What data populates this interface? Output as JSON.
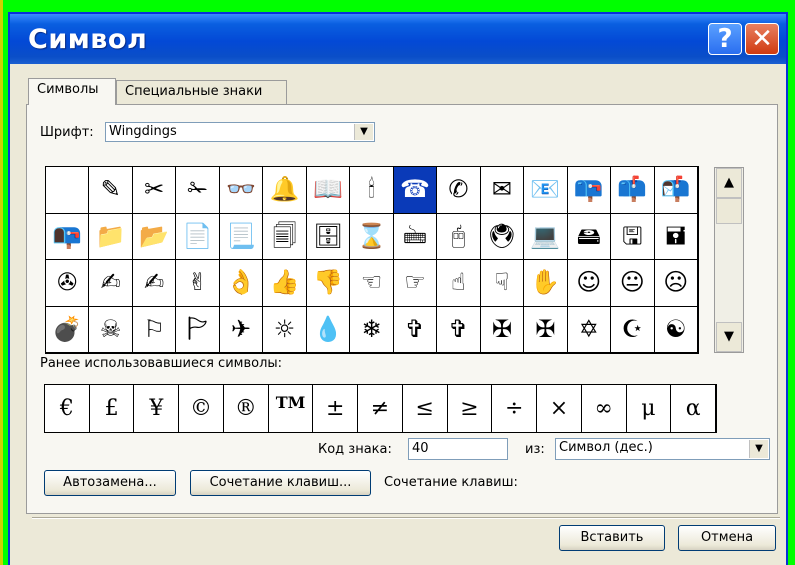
{
  "window": {
    "title": "Символ",
    "help_glyph": "?",
    "close_glyph": "✕"
  },
  "tabs": [
    {
      "label": "Символы",
      "active": true
    },
    {
      "label": "Специальные знаки",
      "active": false
    }
  ],
  "font": {
    "label": "Шрифт:",
    "value": "Wingdings"
  },
  "symbols": [
    [
      "",
      "✎",
      "✂",
      "✁",
      "👓",
      "🔔",
      "📖",
      "🕯",
      "☎",
      "✆",
      "✉",
      "📧",
      "📪",
      "📫",
      "📬"
    ],
    [
      "📭",
      "📁",
      "📂",
      "📄",
      "📃",
      "🗐",
      "🗄",
      "⌛",
      "🖮",
      "🖰",
      "🖲",
      "💻",
      "🖴",
      "🖫",
      "🖬"
    ],
    [
      "✇",
      "✍",
      "✍",
      "✌",
      "👌",
      "👍",
      "👎",
      "☜",
      "☞",
      "☝",
      "☟",
      "✋",
      "☺",
      "😐",
      "☹"
    ],
    [
      "💣",
      "☠",
      "⚐",
      "🏱",
      "✈",
      "☼",
      "💧",
      "❄",
      "✞",
      "✞",
      "✠",
      "✠",
      "✡",
      "☪",
      "☯"
    ]
  ],
  "selected_symbol": "☎",
  "recent": {
    "label": "Ранее использовавшиеся символы:",
    "items": [
      "€",
      "£",
      "¥",
      "©",
      "®",
      "TM",
      "±",
      "≠",
      "≤",
      "≥",
      "÷",
      "×",
      "∞",
      "μ",
      "α"
    ]
  },
  "code": {
    "label": "Код знака:",
    "value": "40",
    "from_label": "из:",
    "from_value": "Символ (дес.)"
  },
  "buttons": {
    "autocorrect": "Автозамена...",
    "shortcut_key": "Сочетание клавиш...",
    "shortcut_label": "Сочетание клавиш:",
    "insert": "Вставить",
    "cancel": "Отмена"
  },
  "scroll": {
    "up": "▲",
    "down": "▼"
  },
  "colors": {
    "titlebar": "#0349d6",
    "selection": "#0a3ab8",
    "background": "#00ff00"
  }
}
